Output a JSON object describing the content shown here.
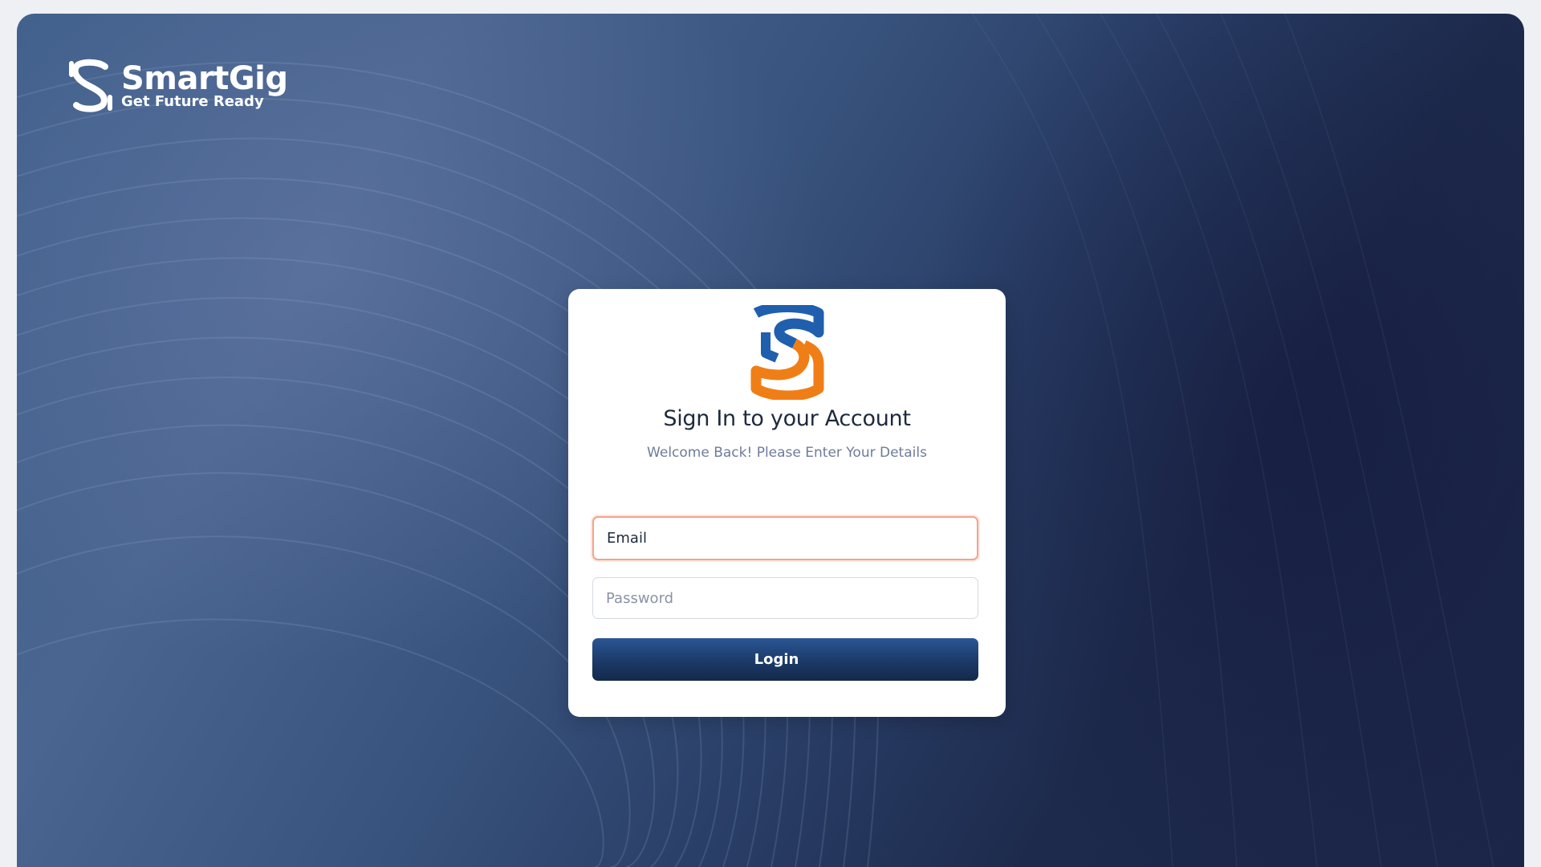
{
  "brand": {
    "name": "SmartGig",
    "tagline": "Get Future Ready"
  },
  "login_card": {
    "title": "Sign In to your Account",
    "subtitle": "Welcome Back! Please Enter Your Details",
    "email_placeholder": "Email",
    "password_placeholder": "Password",
    "login_label": "Login"
  },
  "icons": {
    "brand_logo": "smartgig-s-logo-white",
    "card_logo": "smartgig-s-logo-color"
  },
  "colors": {
    "logo_blue": "#1f5fae",
    "logo_orange": "#f07e16",
    "button_top": "#2b5694",
    "button_bottom": "#14294a",
    "focus_border": "#f2a48c",
    "title": "#1e2a3d",
    "subtitle": "#6e7c9a"
  }
}
